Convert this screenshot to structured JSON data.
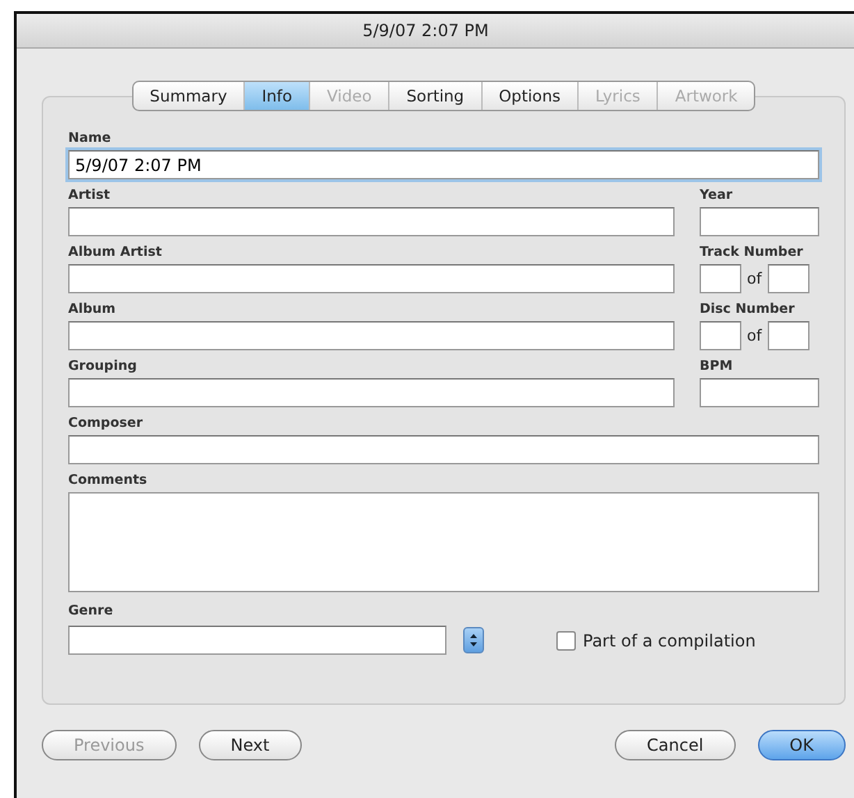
{
  "window": {
    "title": "5/9/07 2:07 PM"
  },
  "tabs": [
    {
      "label": "Summary",
      "selected": false,
      "disabled": false
    },
    {
      "label": "Info",
      "selected": true,
      "disabled": false
    },
    {
      "label": "Video",
      "selected": false,
      "disabled": true
    },
    {
      "label": "Sorting",
      "selected": false,
      "disabled": false
    },
    {
      "label": "Options",
      "selected": false,
      "disabled": false
    },
    {
      "label": "Lyrics",
      "selected": false,
      "disabled": true
    },
    {
      "label": "Artwork",
      "selected": false,
      "disabled": true
    }
  ],
  "fields": [
    {
      "kind": "full",
      "label": "Name",
      "value": "5/9/07 2:07 PM",
      "focused": true
    },
    {
      "kind": "wide",
      "label": "Artist"
    },
    {
      "kind": "narrow",
      "label": "Year"
    },
    {
      "kind": "wide",
      "label": "Album Artist"
    },
    {
      "kind": "pair",
      "label": "Track Number",
      "separator": "of"
    },
    {
      "kind": "wide",
      "label": "Album"
    },
    {
      "kind": "pair",
      "label": "Disc Number",
      "separator": "of"
    },
    {
      "kind": "wide",
      "label": "Grouping"
    },
    {
      "kind": "narrow",
      "label": "BPM"
    },
    {
      "kind": "full",
      "label": "Composer"
    },
    {
      "kind": "area",
      "label": "Comments"
    }
  ],
  "genre": {
    "label": "Genre"
  },
  "compilation": {
    "label": "Part of a compilation",
    "checked": false
  },
  "left_buttons": [
    {
      "label": "Previous",
      "disabled": true,
      "default": false
    },
    {
      "label": "Next",
      "disabled": false,
      "default": false
    }
  ],
  "right_buttons": [
    {
      "label": "Cancel",
      "disabled": false,
      "default": false
    },
    {
      "label": "OK",
      "disabled": false,
      "default": true
    }
  ]
}
